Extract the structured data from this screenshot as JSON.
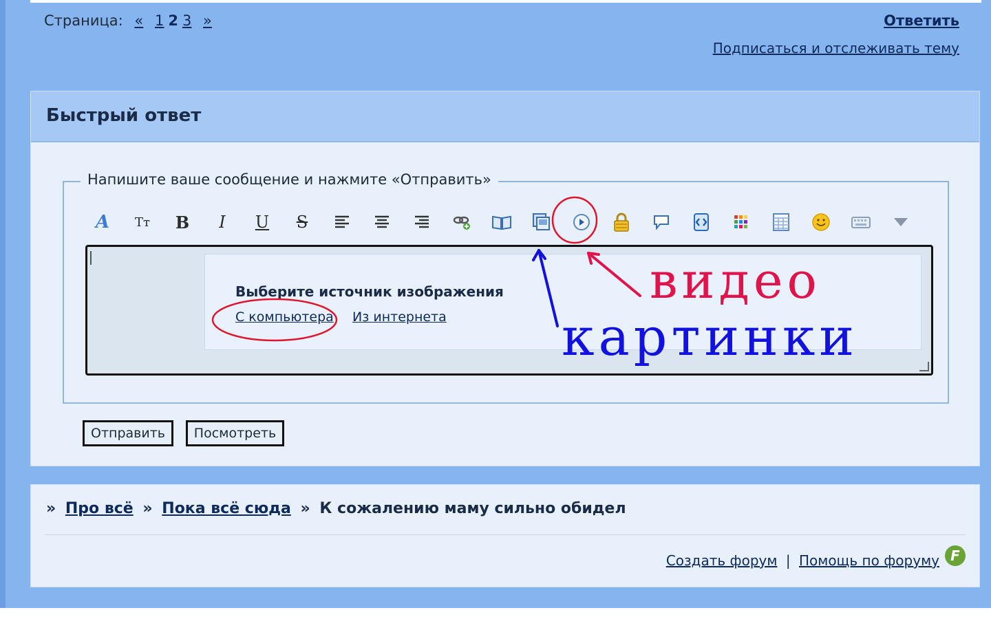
{
  "pagination": {
    "label": "Страница:",
    "prev": "«",
    "pages": [
      "1",
      "2",
      "3"
    ],
    "next": "»"
  },
  "topic_actions": {
    "reply": "Ответить",
    "subscribe": "Подписаться и отслеживать тему"
  },
  "quick_reply": {
    "title": "Быстрый ответ",
    "legend": "Напишите ваше сообщение и нажмите «Отправить»",
    "toolbar": {
      "font_icon": "A",
      "size_icon": "Tт",
      "bold": "B",
      "italic": "I",
      "underline": "U",
      "strike": "S"
    },
    "image_popup": {
      "title": "Выберите источник изображения",
      "from_computer": "С компьютера",
      "from_internet": "Из интернета"
    },
    "submit": "Отправить",
    "preview": "Посмотреть"
  },
  "breadcrumb": {
    "sep": "»",
    "items": [
      "Про всё",
      "Пока всё сюда"
    ],
    "current": "К сожалению маму сильно обидел"
  },
  "footer": {
    "create_forum": "Создать форум",
    "divider": "|",
    "help": "Помощь по форуму",
    "logo_letter": "F"
  },
  "annotations": {
    "video": "видео",
    "pictures": "картинки"
  },
  "colors": {
    "page_bg": "#86b4ee",
    "panel_bg": "#e7f0fb",
    "header_bg": "#a6c8f5",
    "link": "#0e2a5c",
    "annot_red": "#e0144a",
    "annot_blue": "#1212e0"
  }
}
